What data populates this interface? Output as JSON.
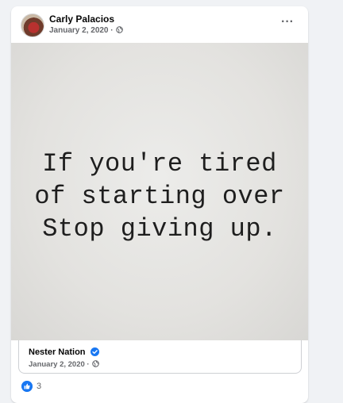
{
  "post": {
    "author": "Carly Palacios",
    "date": "January 2, 2020",
    "separator": "·",
    "audience_icon": "globe-icon",
    "more_icon": "more-options-icon",
    "more_label": "···"
  },
  "image": {
    "quote_text": "If you're tired\nof starting over\nStop giving up."
  },
  "shared_from": {
    "page_name": "Nester Nation",
    "verified_icon": "verified-badge-icon",
    "date": "January 2, 2020",
    "separator": "·",
    "audience_icon": "globe-icon"
  },
  "reactions": {
    "icon": "like-icon",
    "count": "3"
  },
  "colors": {
    "brand_blue": "#1877f2",
    "secondary_text": "#65676b",
    "card_background": "#ffffff",
    "page_background": "#f0f2f5"
  }
}
